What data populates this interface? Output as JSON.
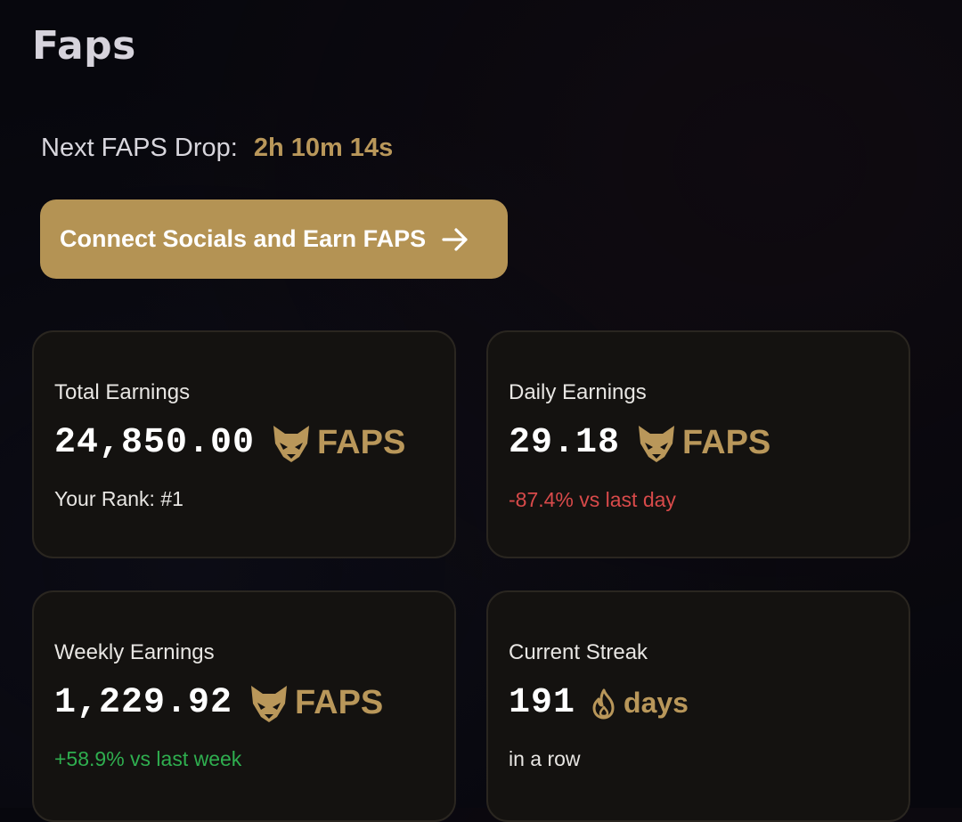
{
  "header": {
    "title": "Faps"
  },
  "drop": {
    "label": "Next FAPS Drop:",
    "timer": "2h 10m 14s"
  },
  "cta": {
    "label": "Connect Socials and Earn FAPS",
    "icon": "arrow-right-icon"
  },
  "colors": {
    "accent": "#b49354",
    "accent_text": "#b9975a",
    "negative": "#d84a4a",
    "positive": "#2fae4f",
    "card_bg": "#141210"
  },
  "cards": [
    {
      "label": "Total Earnings",
      "value": "24,850.00",
      "unit": "FAPS",
      "icon": "fox-logo-icon",
      "sub": "Your Rank: #1"
    },
    {
      "label": "Daily Earnings",
      "value": "29.18",
      "unit": "FAPS",
      "icon": "fox-logo-icon",
      "sub": "-87.4% vs last day"
    },
    {
      "label": "Weekly Earnings",
      "value": "1,229.92",
      "unit": "FAPS",
      "icon": "fox-logo-icon",
      "sub": "+58.9% vs last week"
    },
    {
      "label": "Current Streak",
      "value": "191",
      "unit": "days",
      "icon": "flame-icon",
      "sub": "in a row"
    }
  ]
}
